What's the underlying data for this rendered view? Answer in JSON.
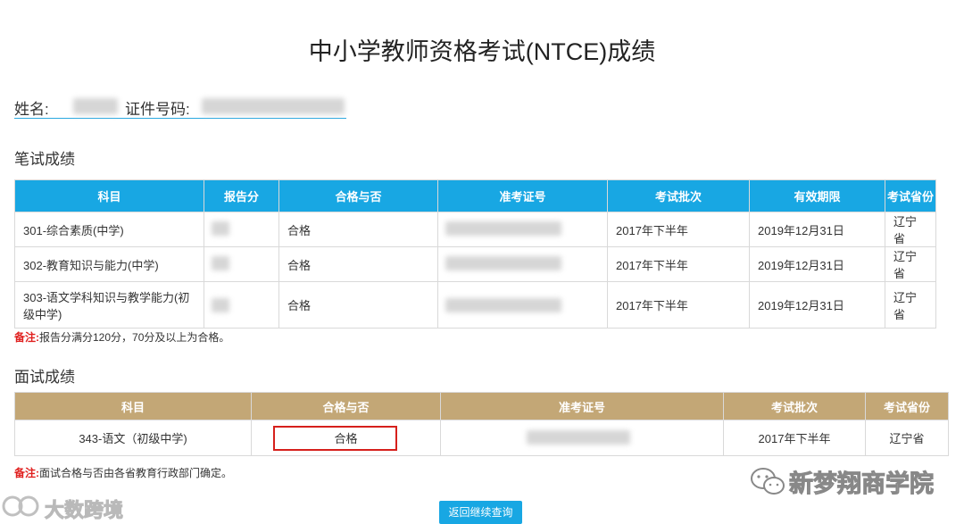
{
  "title": "中小学教师资格考试(NTCE)成绩",
  "info": {
    "name_label": "姓名:",
    "id_label": "证件号码:"
  },
  "written": {
    "section_title": "笔试成绩",
    "headers": [
      "科目",
      "报告分",
      "合格与否",
      "准考证号",
      "考试批次",
      "有效期限",
      "考试省份"
    ],
    "rows": [
      {
        "subject": "301-综合素质(中学)",
        "pass": "合格",
        "batch": "2017年下半年",
        "valid": "2019年12月31日",
        "province": "辽宁省"
      },
      {
        "subject": "302-教育知识与能力(中学)",
        "pass": "合格",
        "batch": "2017年下半年",
        "valid": "2019年12月31日",
        "province": "辽宁省"
      },
      {
        "subject": "303-语文学科知识与教学能力(初级中学)",
        "pass": "合格",
        "batch": "2017年下半年",
        "valid": "2019年12月31日",
        "province": "辽宁省"
      }
    ],
    "note_label": "备注:",
    "note_text": "报告分满分120分，70分及以上为合格。"
  },
  "oral": {
    "section_title": "面试成绩",
    "headers": [
      "科目",
      "合格与否",
      "准考证号",
      "考试批次",
      "考试省份"
    ],
    "row": {
      "subject": "343-语文（初级中学)",
      "pass": "合格",
      "batch": "2017年下半年",
      "province": "辽宁省"
    },
    "note_label": "备注:",
    "note_text": "面试合格与否由各省教育行政部门确定。"
  },
  "button_label": "返回继续查询",
  "watermark_left": "大数跨境",
  "watermark_right": "新梦翔商学院",
  "colors": {
    "written_header": "#18a7e3",
    "oral_header": "#c3a776",
    "highlight_box": "#d6201c",
    "note_label": "#e0201f"
  }
}
